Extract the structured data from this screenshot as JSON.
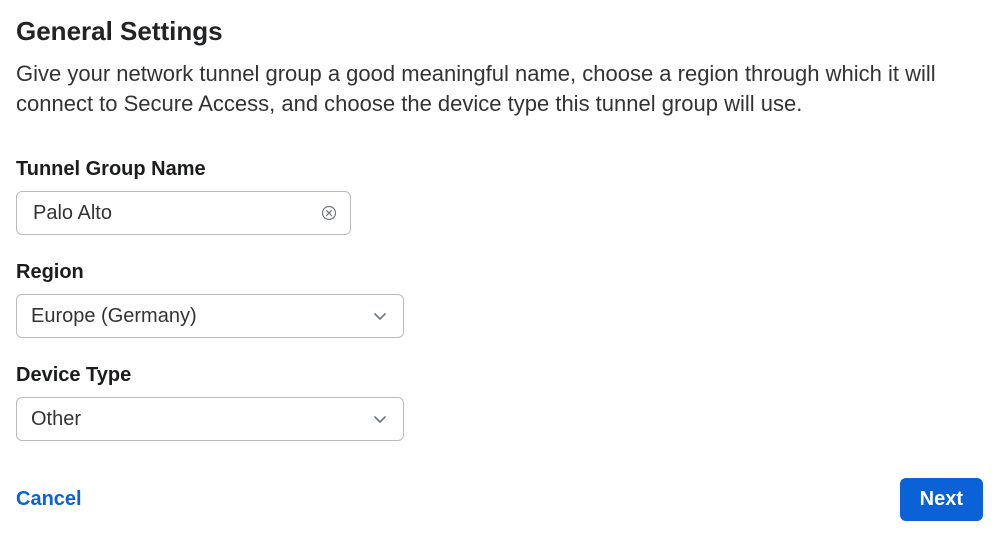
{
  "heading": "General Settings",
  "description": "Give your network tunnel group a good meaningful name, choose a region through which it will connect to Secure Access, and choose the device type this tunnel group will use.",
  "fields": {
    "tunnelGroupName": {
      "label": "Tunnel Group Name",
      "value": "Palo Alto"
    },
    "region": {
      "label": "Region",
      "value": "Europe (Germany)"
    },
    "deviceType": {
      "label": "Device Type",
      "value": "Other"
    }
  },
  "buttons": {
    "cancel": "Cancel",
    "next": "Next"
  }
}
